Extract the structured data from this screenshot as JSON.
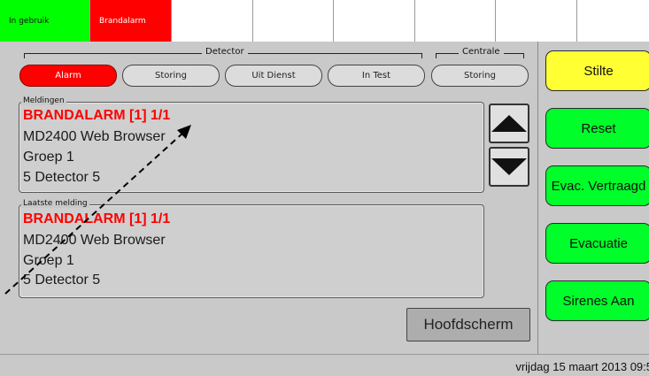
{
  "topbar": {
    "in_use": "In gebruik",
    "fire_alarm": "Brandalarm"
  },
  "filters": {
    "detector_label": "Detector",
    "centrale_label": "Centrale",
    "alarm": "Alarm",
    "storing": "Storing",
    "uit_dienst": "Uit Dienst",
    "in_test": "In Test",
    "centrale_storing": "Storing"
  },
  "messages": {
    "title": "Meldingen",
    "lines": [
      "BRANDALARM [1] 1/1",
      "MD2400 Web Browser",
      "Groep 1",
      "5 Detector 5"
    ]
  },
  "last_message": {
    "title": "Laatste melding",
    "lines": [
      "BRANDALARM [1] 1/1",
      "MD2400 Web Browser",
      "Groep 1",
      "5 Detector 5"
    ]
  },
  "main_button": "Hoofdscherm",
  "side_buttons": {
    "silence": "Stilte",
    "reset": "Reset",
    "evac_delayed": "Evac. Vertraagd",
    "evacuation": "Evacuatie",
    "sirens_on": "Sirenes Aan"
  },
  "status": {
    "datetime": "vrijdag 15 maart 2013 09:5"
  },
  "colors": {
    "green": "#00ff00",
    "red": "#ff0000",
    "yellow": "#ffff33",
    "panel_bg": "#c9c9c9"
  }
}
